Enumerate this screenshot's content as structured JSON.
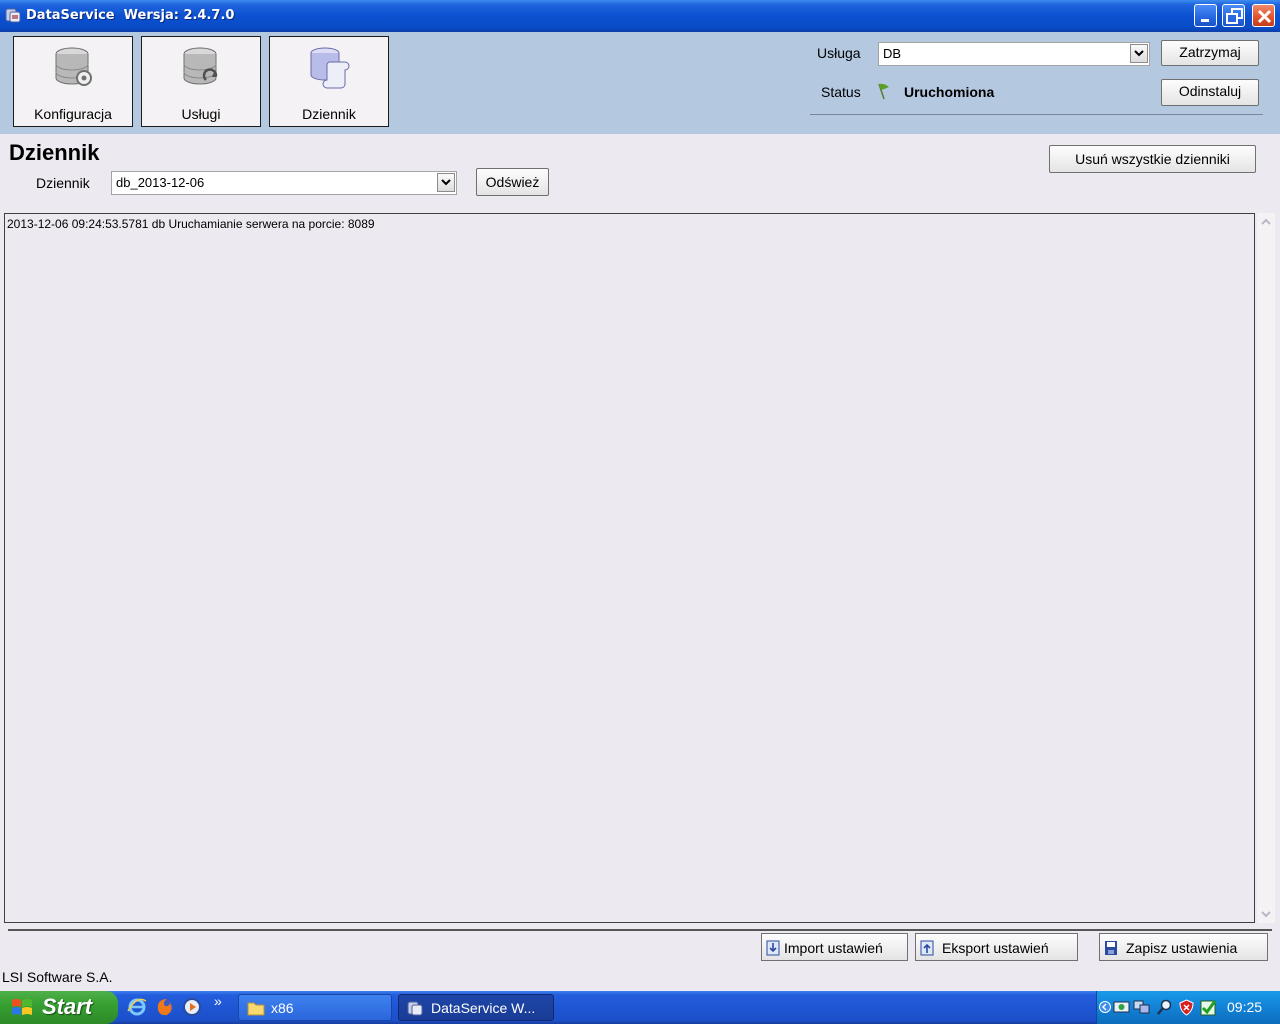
{
  "window": {
    "title": "DataService  Wersja: 2.4.7.0"
  },
  "nav": {
    "konfiguracja": "Konfiguracja",
    "uslugi": "Usługi",
    "dziennik": "Dziennik"
  },
  "service": {
    "label": "Usługa",
    "value": "DB",
    "stop_button": "Zatrzymaj",
    "status_label": "Status",
    "status_value": "Uruchomiona",
    "uninstall_button": "Odinstaluj"
  },
  "page": {
    "title": "Dziennik",
    "log_label": "Dziennik",
    "log_select_value": "db_2013-12-06",
    "refresh_button": "Odśwież",
    "delete_all_button": "Usuń wszystkie dzienniki",
    "log_lines": [
      "2013-12-06 09:24:53.5781 db Uruchamianie serwera na porcie: 8089"
    ]
  },
  "footer": {
    "import_button": "Import ustawień",
    "export_button": "Eksport ustawień",
    "save_button": "Zapisz ustawienia",
    "company": "LSI Software S.A."
  },
  "taskbar": {
    "start": "Start",
    "overflow": "»",
    "task_folder": "x86",
    "task_app": "DataService  W...",
    "clock": "09:25"
  },
  "colors": {
    "header_band": "#b4c8e0",
    "window_bg": "#ece9f0",
    "titlebar": "#0b50d0",
    "status_flag": "#5aa028"
  }
}
